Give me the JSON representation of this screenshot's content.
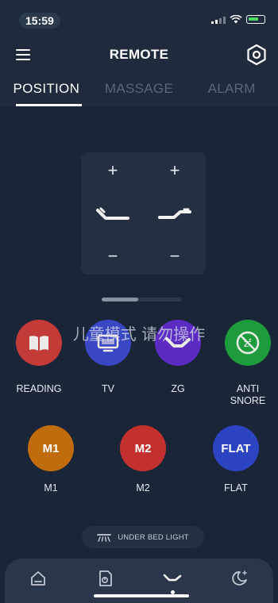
{
  "status_bar": {
    "time": "15:59"
  },
  "header": {
    "title": "REMOTE",
    "menu_icon": "menu-icon",
    "settings_icon": "settings-hexagon-icon"
  },
  "tabs": [
    {
      "label": "POSITION",
      "active": true
    },
    {
      "label": "MASSAGE",
      "active": false
    },
    {
      "label": "ALARM",
      "active": false
    }
  ],
  "position_control": {
    "head_up": "+",
    "head_down": "−",
    "foot_up": "+",
    "foot_down": "−",
    "head_icon": "bed-head-raise-icon",
    "foot_icon": "bed-foot-raise-icon"
  },
  "pager": {
    "pages": 2,
    "active": 1
  },
  "watermark": "儿童模式 请勿操作",
  "presets_row1": [
    {
      "label": "READING",
      "icon": "book-icon",
      "color": "#c33b37"
    },
    {
      "label": "TV",
      "icon": "tv-icon",
      "color": "#3a47c4"
    },
    {
      "label": "ZG",
      "icon": "zero-gravity-icon",
      "color": "#5b2bc2"
    },
    {
      "label": "ANTI\nSNORE",
      "icon": "anti-snore-icon",
      "color": "#1e9b3c"
    }
  ],
  "presets_row2": [
    {
      "label": "M1",
      "text": "M1",
      "color": "#c06b0c"
    },
    {
      "label": "M2",
      "text": "M2",
      "color": "#c3312f"
    },
    {
      "label": "FLAT",
      "text": "FLAT",
      "color": "#2d44c2"
    }
  ],
  "under_bed_light": {
    "label": "UNDER BED LIGHT",
    "icon": "under-bed-light-icon"
  },
  "bottom_nav": [
    {
      "name": "home",
      "icon": "home-icon"
    },
    {
      "name": "document",
      "icon": "document-icon"
    },
    {
      "name": "bed",
      "icon": "bed-position-icon",
      "active": true
    },
    {
      "name": "sleep",
      "icon": "moon-stars-icon"
    }
  ]
}
